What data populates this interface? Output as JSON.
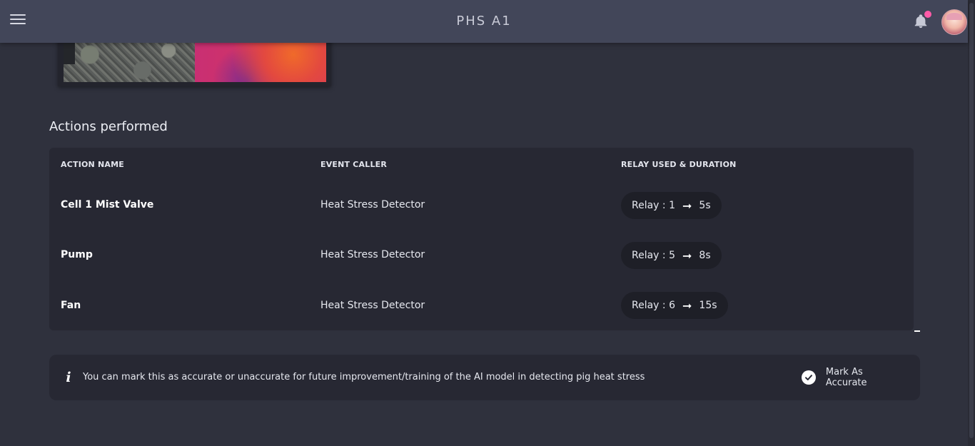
{
  "header": {
    "title": "PHS A1",
    "notification_dot_color": "#ff5ba8"
  },
  "actions": {
    "section_title": "Actions performed",
    "columns": [
      "ACTION NAME",
      "EVENT CALLER",
      "RELAY USED & DURATION"
    ],
    "rows": [
      {
        "action_name": "Cell 1 Mist Valve",
        "event_caller": "Heat Stress Detector",
        "relay": "Relay : 1",
        "duration": "5s"
      },
      {
        "action_name": "Pump",
        "event_caller": "Heat Stress Detector",
        "relay": "Relay : 5",
        "duration": "8s"
      },
      {
        "action_name": "Fan",
        "event_caller": "Heat Stress Detector",
        "relay": "Relay : 6",
        "duration": "15s"
      }
    ]
  },
  "feedback": {
    "info_text": "You can mark this as accurate or unaccurate for future improvement/training of the AI model in detecting pig heat stress",
    "mark_label": "Mark As Accurate"
  },
  "icons": {
    "menu": "hamburger-menu-icon",
    "bell": "bell-icon",
    "info": "info-icon",
    "check": "check-circle-icon",
    "arrow": "arrow-right-icon"
  }
}
